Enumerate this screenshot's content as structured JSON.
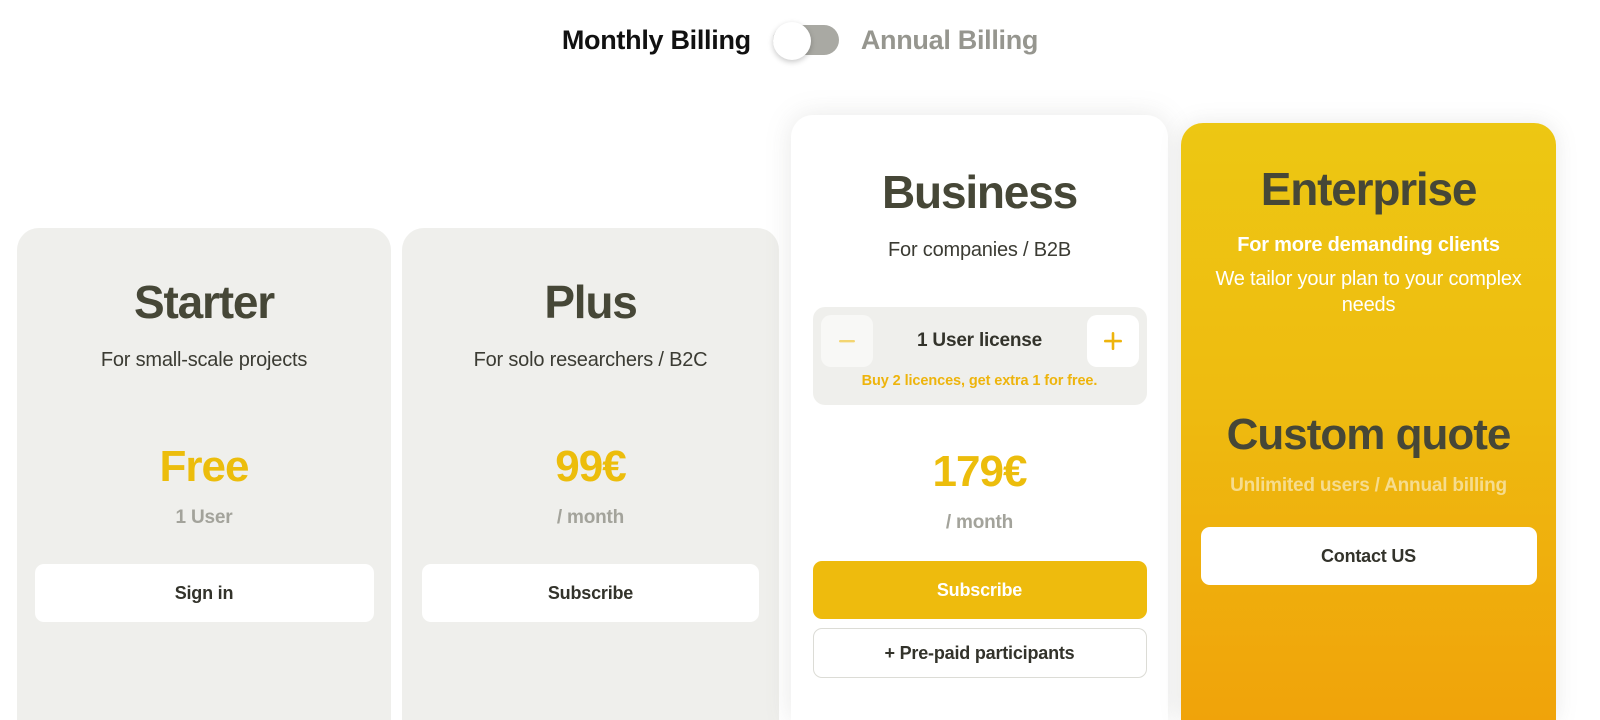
{
  "billing": {
    "monthly_label": "Monthly Billing",
    "annual_label": "Annual Billing",
    "selected": "Monthly Billing",
    "toggle_position": "left"
  },
  "theme": {
    "accent_yellow": "#ecbd0c",
    "accent_yellow_bright": "#eebb0d",
    "accent_orange": "#f0a30a",
    "title_dark": "#464737",
    "muted_grey": "#a3a39b",
    "card_grey": "#efefec",
    "page_background": "#ffffff"
  },
  "plans": [
    {
      "id": "starter",
      "title": "Starter",
      "subtitle": "For small-scale projects",
      "price": "Free",
      "price_note": "1 User",
      "primary_button": "Sign in"
    },
    {
      "id": "plus",
      "title": "Plus",
      "subtitle": "For solo researchers / B2C",
      "price": "99€",
      "price_note": "/ month",
      "primary_button": "Subscribe"
    },
    {
      "id": "business",
      "title": "Business",
      "subtitle": "For companies / B2B",
      "price": "179€",
      "price_note": "/ month",
      "primary_button": "Subscribe",
      "secondary_button": "+ Pre-paid participants",
      "stepper": {
        "value_label": "1 User license",
        "quantity": 1,
        "decrement_icon": "minus-icon",
        "increment_icon": "plus-icon",
        "decrement_enabled": false,
        "increment_enabled": true,
        "promo": "Buy 2 licences, get extra 1 for free."
      }
    },
    {
      "id": "enterprise",
      "title": "Enterprise",
      "subtitle_strong": "For more demanding clients",
      "subtitle": "We tailor your plan to your complex needs",
      "price": "Custom quote",
      "price_note": "Unlimited users / Annual billing",
      "primary_button": "Contact US"
    }
  ]
}
